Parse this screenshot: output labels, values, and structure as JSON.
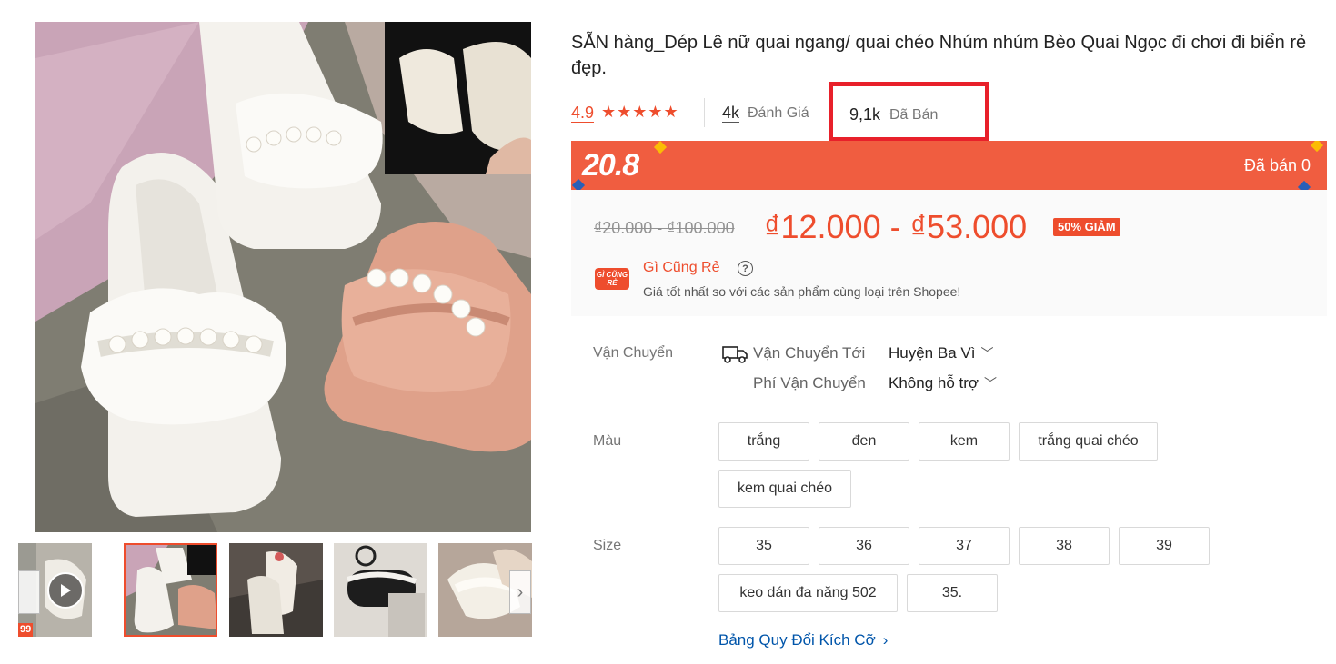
{
  "product": {
    "title": "SẴN hàng_Dép Lê nữ quai ngang/ quai chéo Nhúm nhúm Bèo Quai Ngọc đi chơi đi biển rẻ đẹp.",
    "rating": "4.9",
    "stars": "★★★★★",
    "reviews_count": "4k",
    "reviews_label": "Đánh Giá",
    "sold_count": "9,1k",
    "sold_label": "Đã Bán"
  },
  "flash_sale": {
    "logo": "20.8",
    "sold_text": "Đã bán 0"
  },
  "price": {
    "original": "₫20.000 - ₫100.000",
    "current": "₫12.000 - ₫53.000",
    "discount": "50% GIẢM"
  },
  "cheap": {
    "logo": "GÌ CŨNG RẺ",
    "title": "Gì Cũng Rẻ",
    "help": "?",
    "desc": "Giá tốt nhất so với các sản phẩm cùng loại trên Shopee!"
  },
  "shipping": {
    "label": "Vận Chuyển",
    "to_label": "Vận Chuyển Tới",
    "to_value": "Huyện Ba Vì",
    "fee_label": "Phí Vận Chuyển",
    "fee_value": "Không hỗ trợ"
  },
  "color": {
    "label": "Màu",
    "options": [
      "trắng",
      "đen",
      "kem",
      "trắng quai chéo",
      "kem quai chéo"
    ]
  },
  "size": {
    "label": "Size",
    "options": [
      "35",
      "36",
      "37",
      "38",
      "39",
      "keo dán đa năng 502",
      "35."
    ]
  },
  "size_guide": "Bảng Quy Đổi Kích Cỡ",
  "gallery": {
    "badge": "99",
    "thumbnail_count": 5
  },
  "colors": {
    "accent": "#ee4d2d",
    "flash_bg": "#f05d40",
    "highlight_box": "#e8202a",
    "link": "#0055aa"
  }
}
